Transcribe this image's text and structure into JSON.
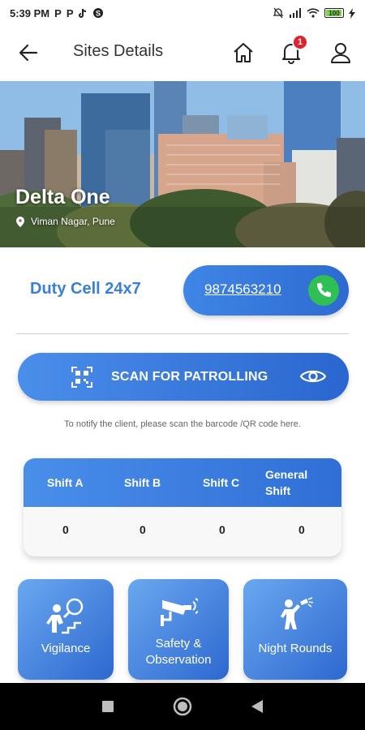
{
  "status_bar": {
    "time": "5:39 PM",
    "notif_icons": [
      "p-icon",
      "p-icon",
      "tiktok-icon",
      "skype-icon"
    ],
    "battery": "100"
  },
  "header": {
    "title": "Sites Details",
    "notification_count": "1"
  },
  "site": {
    "name": "Delta One",
    "location": "Viman Nagar, Pune"
  },
  "duty": {
    "label": "Duty Cell 24x7",
    "phone": "9874563210"
  },
  "scan": {
    "label": "SCAN FOR PATROLLING",
    "hint": "To notify the client, please scan the barcode /QR code here."
  },
  "shifts": {
    "headers": [
      "Shift A",
      "Shift B",
      "Shift C",
      "General Shift"
    ],
    "values": [
      "0",
      "0",
      "0",
      "0"
    ]
  },
  "tiles": [
    {
      "label": "Vigilance",
      "icon": "vigilance-icon"
    },
    {
      "label": "Safety & Observation",
      "icon": "cctv-icon"
    },
    {
      "label": "Night Rounds",
      "icon": "flashlight-guard-icon"
    }
  ],
  "colors": {
    "primary": "#3a7fd6",
    "call_green": "#2fbf55",
    "badge_red": "#e0202a"
  }
}
